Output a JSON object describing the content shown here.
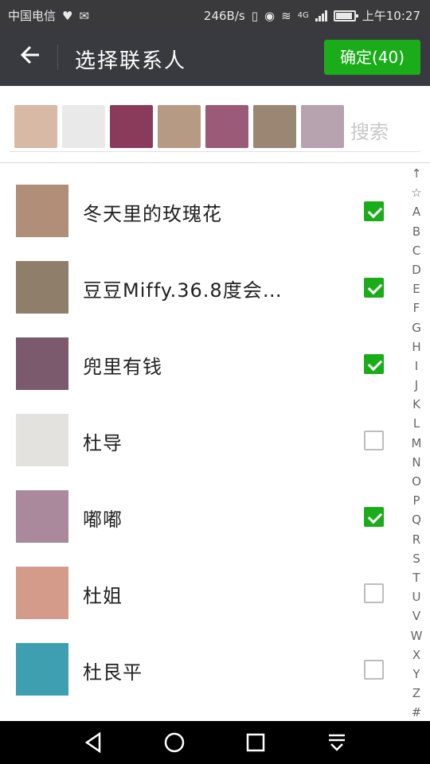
{
  "status_bar": {
    "carrier": "中国电信",
    "speed": "246B/s",
    "net": "4G",
    "time": "上午10:27"
  },
  "header": {
    "back_icon": "arrow-left-icon",
    "title": "选择联系人",
    "confirm_label": "确定(40)"
  },
  "selected_strip": {
    "avatars": [
      {
        "name": "avatar-woman-1",
        "color": "#d8b9a6"
      },
      {
        "name": "avatar-man-suit",
        "color": "#e9e9e9"
      },
      {
        "name": "avatar-dress",
        "color": "#8a3b5b"
      },
      {
        "name": "avatar-woman-2",
        "color": "#b79a84"
      },
      {
        "name": "avatar-flowers",
        "color": "#9b5a78"
      },
      {
        "name": "avatar-child",
        "color": "#9a8673"
      },
      {
        "name": "avatar-woman-flowers",
        "color": "#b7a2b0"
      }
    ],
    "search_placeholder": "搜索"
  },
  "contacts": [
    {
      "name": "冬天里的玫瑰花",
      "checked": true,
      "color": "#b08e78"
    },
    {
      "name": "豆豆Miffy.36.8度会…",
      "checked": true,
      "color": "#8f7f6a"
    },
    {
      "name": "兜里有钱",
      "checked": true,
      "color": "#7c5a6e"
    },
    {
      "name": "杜导",
      "checked": false,
      "color": "#e4e2df"
    },
    {
      "name": "嘟嘟",
      "checked": true,
      "color": "#a9899b"
    },
    {
      "name": "杜姐",
      "checked": false,
      "color": "#d49b8b"
    },
    {
      "name": "杜艮平",
      "checked": false,
      "color": "#3e9fb0"
    }
  ],
  "index_letters": [
    "↑",
    "☆",
    "A",
    "B",
    "C",
    "D",
    "E",
    "F",
    "G",
    "H",
    "I",
    "J",
    "K",
    "L",
    "M",
    "N",
    "O",
    "P",
    "Q",
    "R",
    "S",
    "T",
    "U",
    "V",
    "W",
    "X",
    "Y",
    "Z",
    "#"
  ],
  "nav": {
    "back_icon": "triangle-back-icon",
    "home_icon": "circle-home-icon",
    "recent_icon": "square-recent-icon",
    "menu_icon": "down-arrow-icon"
  },
  "colors": {
    "accent": "#1aad19",
    "header_bg": "#393a3f"
  }
}
